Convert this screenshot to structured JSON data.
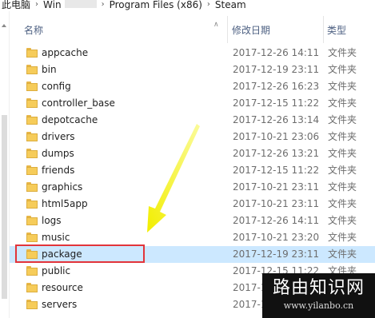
{
  "breadcrumb": {
    "items": [
      "此电脑",
      "Win",
      "Program Files (x86)",
      "Steam"
    ]
  },
  "columns": {
    "name": "名称",
    "date": "修改日期",
    "type": "类型"
  },
  "rows": [
    {
      "name": "appcache",
      "date": "2017-12-26 14:11",
      "type": "文件夹",
      "selected": false
    },
    {
      "name": "bin",
      "date": "2017-12-19 23:11",
      "type": "文件夹",
      "selected": false
    },
    {
      "name": "config",
      "date": "2017-12-26 16:23",
      "type": "文件夹",
      "selected": false
    },
    {
      "name": "controller_base",
      "date": "2017-12-15 11:22",
      "type": "文件夹",
      "selected": false
    },
    {
      "name": "depotcache",
      "date": "2017-12-26 13:14",
      "type": "文件夹",
      "selected": false
    },
    {
      "name": "drivers",
      "date": "2017-10-21 23:06",
      "type": "文件夹",
      "selected": false
    },
    {
      "name": "dumps",
      "date": "2017-12-26 13:21",
      "type": "文件夹",
      "selected": false
    },
    {
      "name": "friends",
      "date": "2017-12-15 11:22",
      "type": "文件夹",
      "selected": false
    },
    {
      "name": "graphics",
      "date": "2017-10-21 23:11",
      "type": "文件夹",
      "selected": false
    },
    {
      "name": "html5app",
      "date": "2017-10-21 23:11",
      "type": "文件夹",
      "selected": false
    },
    {
      "name": "logs",
      "date": "2017-12-26 14:11",
      "type": "文件夹",
      "selected": false
    },
    {
      "name": "music",
      "date": "2017-10-21 23:20",
      "type": "文件夹",
      "selected": false
    },
    {
      "name": "package",
      "date": "2017-12-19 23:11",
      "type": "文件夹",
      "selected": true
    },
    {
      "name": "public",
      "date": "2017-12-15 11:22",
      "type": "文件夹",
      "selected": false
    },
    {
      "name": "resource",
      "date": "2017-12-19 23:11",
      "type": "文件夹",
      "selected": false
    },
    {
      "name": "servers",
      "date": "2017-12-26 13:23",
      "type": "文件夹",
      "selected": false
    }
  ],
  "watermark": {
    "title": "路由知识网",
    "url": "www.yilanbo.cn"
  },
  "colors": {
    "selection": "#cce8ff",
    "highlight_border": "#e2343a",
    "folder": "#f6cc5a",
    "arrow": "#f5f000"
  },
  "icons": {
    "folder": "folder-icon",
    "arrow": "yellow-arrow"
  }
}
